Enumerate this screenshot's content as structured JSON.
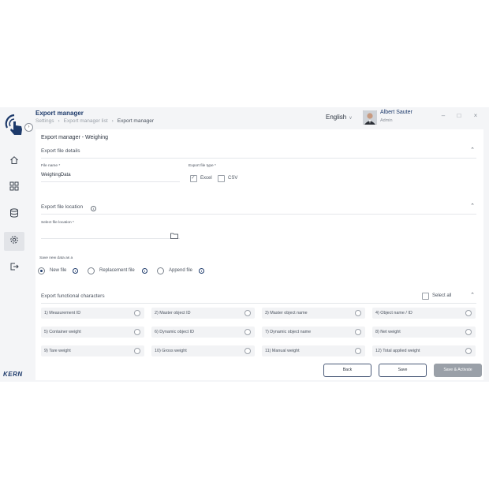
{
  "window": {
    "title": "Export manager",
    "breadcrumb": [
      "Settings",
      "Export manager list",
      "Export manager"
    ],
    "language": "English",
    "user": {
      "name": "Albert Sauter",
      "role": "Admin"
    },
    "controls": {
      "minimize": "–",
      "maximize": "□",
      "close": "×"
    }
  },
  "sidebar": {
    "items": [
      {
        "icon": "home-icon"
      },
      {
        "icon": "dashboard-icon"
      },
      {
        "icon": "database-icon"
      },
      {
        "icon": "gear-icon",
        "active": true
      },
      {
        "icon": "logout-icon"
      }
    ],
    "brand": "KERN"
  },
  "panel": {
    "title": "Export manager - Weighing",
    "file_details": {
      "heading": "Export file details",
      "file_name_label": "File name *",
      "file_name_value": "WeighingData",
      "file_type_label": "Export file type *",
      "types": [
        {
          "label": "Excel",
          "checked": true
        },
        {
          "label": "CSV",
          "checked": false
        }
      ]
    },
    "file_location": {
      "heading": "Export file location",
      "location_label": "Select file location *",
      "location_value": ""
    },
    "save_as": {
      "label": "Save new data as a",
      "options": [
        {
          "label": "New file",
          "selected": true
        },
        {
          "label": "Replacement file",
          "selected": false
        },
        {
          "label": "Append file",
          "selected": false
        }
      ]
    },
    "functional": {
      "heading": "Export functional characters",
      "select_all": "Select all",
      "items": [
        "1)  Measurement ID",
        "2)  Master object ID",
        "3)  Master object name",
        "4)  Object name / ID",
        "5)  Container weight",
        "6)  Dynamic object ID",
        "7)  Dynamic object name",
        "8)  Net weight",
        "9)  Tare weight",
        "10)  Gross weight",
        "11)  Manual weight",
        "12)  Total applied weight"
      ]
    },
    "buttons": {
      "back": "Back",
      "save": "Save",
      "save_activate": "Save & Activate"
    }
  },
  "colors": {
    "accent": "#1d3a6b",
    "background": "#f4f5f7",
    "disabled_button": "#9aa0a8"
  }
}
